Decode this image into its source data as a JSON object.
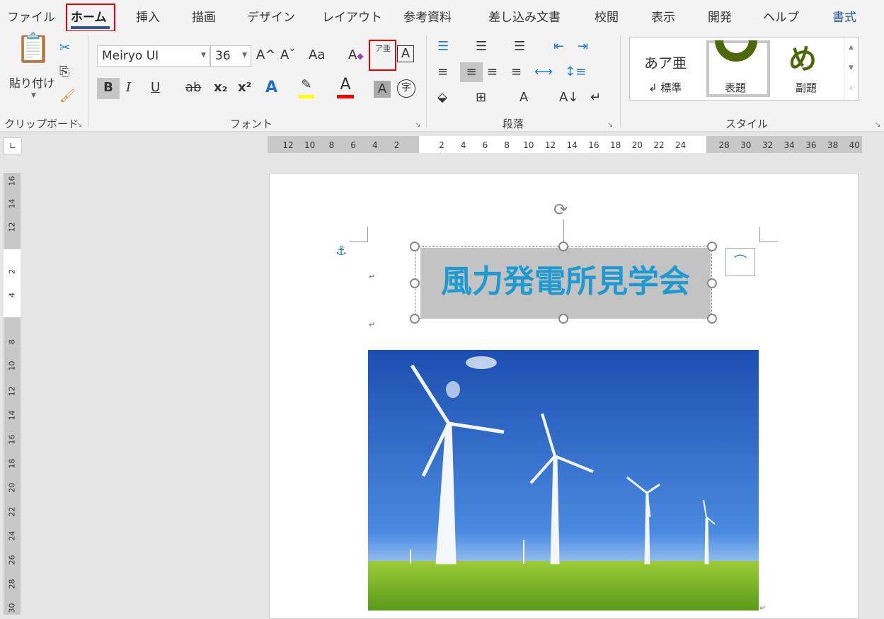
{
  "tabs": [
    "ファイル",
    "ホーム",
    "挿入",
    "描画",
    "デザイン",
    "レイアウト",
    "参考資料",
    "差し込み文書",
    "校閲",
    "表示",
    "開発",
    "ヘルプ",
    "書式"
  ],
  "active_tab": "ホーム",
  "clipboard": {
    "paste_label": "貼り付け",
    "group_label": "クリップボード"
  },
  "font": {
    "name": "Meiryo UI",
    "size": "36",
    "group_label": "フォント",
    "phonetic_guide": "ア亜",
    "buttons": {
      "bold": "B",
      "italic": "I",
      "underline": "U",
      "strike": "ab",
      "sub": "x₂",
      "sup": "x²",
      "grow": "A^",
      "shrink": "Aˇ",
      "case": "Aa",
      "enclose": "字"
    }
  },
  "paragraph": {
    "group_label": "段落"
  },
  "styles": {
    "group_label": "スタイル",
    "items": [
      {
        "preview": "あア亜",
        "label": "標準"
      },
      {
        "preview": "",
        "label": "表題"
      },
      {
        "preview": "め",
        "label": "副題"
      }
    ]
  },
  "colors": {
    "highlight": "#ffff00",
    "font_color": "#ff0000",
    "title_text": "#1e9ad1",
    "style_preview": "#4a6a0a"
  },
  "ruler": {
    "left": [
      "12",
      "10",
      "8",
      "6",
      "4",
      "2"
    ],
    "right": [
      "2",
      "4",
      "6",
      "8",
      "10",
      "12",
      "14",
      "16",
      "18",
      "20",
      "22",
      "24",
      "28",
      "30",
      "32",
      "34",
      "36",
      "38",
      "40"
    ],
    "vertical": [
      "16",
      "14",
      "12",
      "2",
      "4",
      "8",
      "10",
      "12",
      "14",
      "16",
      "18",
      "20",
      "22",
      "24",
      "26",
      "28",
      "30"
    ]
  },
  "document": {
    "title": "風力発電所見学会"
  }
}
